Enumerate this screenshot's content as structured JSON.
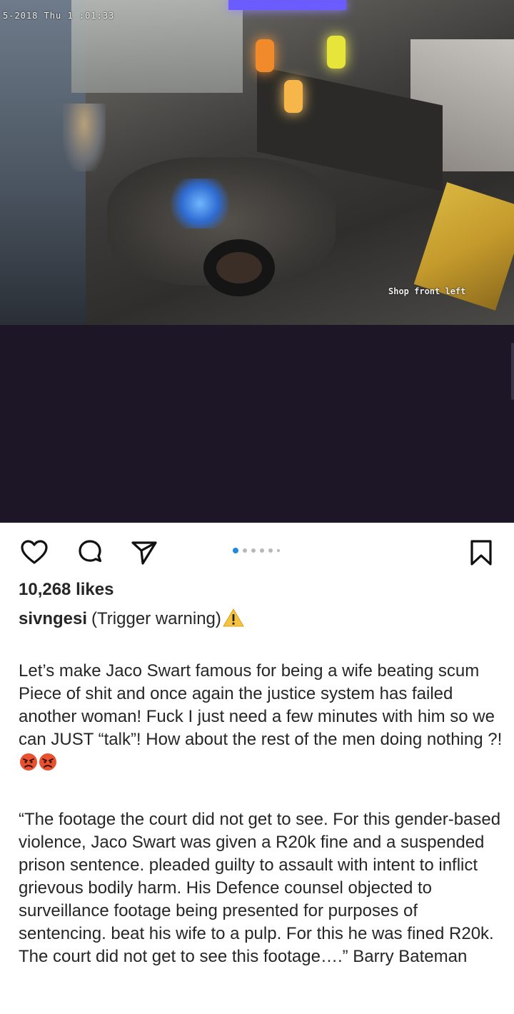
{
  "media": {
    "timestamp": "5-2018 Thu 1 :01:33",
    "camera_label": "Shop front left",
    "carousel": {
      "count": 6,
      "active_index": 0
    }
  },
  "actions": {
    "icons": [
      "heart-icon",
      "comment-icon",
      "share-icon",
      "bookmark-icon"
    ]
  },
  "post": {
    "likes": "10,268 likes",
    "username": "sivngesi",
    "headline": "(Trigger warning)",
    "headline_emoji": "warning-icon",
    "paragraph1": "Let’s make Jaco Swart famous for being a wife beating scum Piece of shit and once again the justice system has failed another woman! Fuck I just need a few minutes with him so we can JUST “talk”! How about the rest of the men doing nothing ?!",
    "paragraph1_emojis": [
      "angry-face-icon",
      "angry-face-icon"
    ],
    "paragraph2": "“The footage the court did not get to see. For this gender-based violence, Jaco Swart was given a R20k fine and a suspended prison sentence. pleaded guilty to assault with intent to inflict grievous bodily harm. His Defence counsel objected to surveillance footage being presented for purposes of sentencing. beat his wife to a pulp. For this he was fined R20k. The court did not get to see this footage….” Barry Bateman"
  },
  "colors": {
    "media_background": "#1d1627",
    "text": "#262626",
    "carousel_active": "#1e88e5",
    "carousel_inactive": "#b8b8b8"
  }
}
